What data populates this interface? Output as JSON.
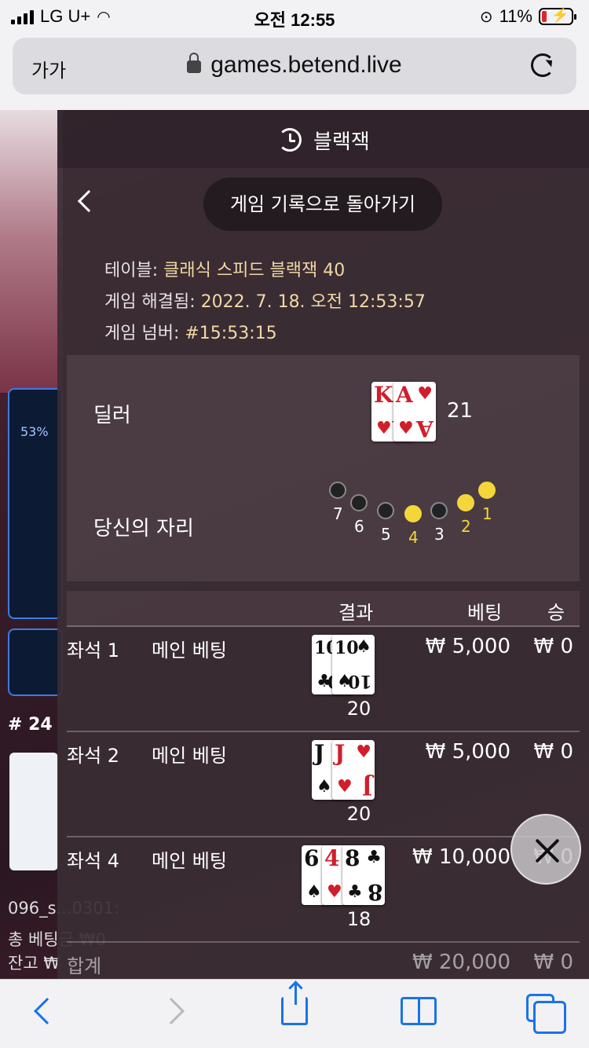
{
  "status_bar": {
    "carrier": "LG U+",
    "time": "오전 12:55",
    "battery": "11%"
  },
  "browser": {
    "text_size_label": "가가",
    "url": "games.betend.live"
  },
  "background_page": {
    "progress_percent": "53%",
    "round_label": "# 24",
    "username": "096_s...0301:",
    "total_bet": "총 베팅금 ₩0",
    "balance": "잔고 ₩"
  },
  "panel": {
    "title": "블랙잭",
    "back_button": "게임 기록으로 돌아가기",
    "info": {
      "table_label": "테이블:",
      "table_value": "클래식 스피드 블랙잭 40",
      "resolved_label": "게임 해결됨:",
      "resolved_value": "2022. 7. 18. 오전 12:53:57",
      "number_label": "게임 넘버:",
      "number_value": "#15:53:15"
    },
    "dealer": {
      "label": "딜러",
      "score": "21",
      "cards": [
        {
          "rank": "K",
          "suit": "♥",
          "color": "#d01f2b"
        },
        {
          "rank": "A",
          "suit": "♥",
          "color": "#d01f2b"
        }
      ]
    },
    "your_seat": {
      "label": "당신의 자리",
      "seats": [
        {
          "num": "7",
          "active": false
        },
        {
          "num": "6",
          "active": false
        },
        {
          "num": "5",
          "active": false
        },
        {
          "num": "4",
          "active": true
        },
        {
          "num": "3",
          "active": false
        },
        {
          "num": "2",
          "active": true
        },
        {
          "num": "1",
          "active": true
        }
      ]
    },
    "table": {
      "headers": {
        "result": "결과",
        "bet": "베팅",
        "win": "승"
      },
      "rows": [
        {
          "seat": "좌석 1",
          "bet_type": "메인 베팅",
          "bet": "₩ 5,000",
          "win": "₩ 0",
          "total": "20",
          "cards": [
            {
              "rank": "10",
              "suit": "♣",
              "color": "#111111"
            },
            {
              "rank": "10",
              "suit": "♠",
              "color": "#111111"
            }
          ]
        },
        {
          "seat": "좌석 2",
          "bet_type": "메인 베팅",
          "bet": "₩ 5,000",
          "win": "₩ 0",
          "total": "20",
          "cards": [
            {
              "rank": "J",
              "suit": "♠",
              "color": "#111111"
            },
            {
              "rank": "J",
              "suit": "♥",
              "color": "#d01f2b"
            }
          ]
        },
        {
          "seat": "좌석 4",
          "bet_type": "메인 베팅",
          "bet": "₩ 10,000",
          "win": "₩ 0",
          "total": "18",
          "cards": [
            {
              "rank": "6",
              "suit": "♠",
              "color": "#111111"
            },
            {
              "rank": "4",
              "suit": "♥",
              "color": "#d01f2b"
            },
            {
              "rank": "8",
              "suit": "♣",
              "color": "#111111"
            }
          ]
        }
      ],
      "sum": {
        "label": "합계",
        "bet": "₩ 20,000",
        "win": "₩ 0"
      }
    }
  },
  "icons": {
    "history": "history-icon",
    "back": "chevron-left-icon",
    "close": "close-icon",
    "share": "share-icon",
    "bookmarks": "bookmarks-icon",
    "tabs": "tabs-icon"
  }
}
